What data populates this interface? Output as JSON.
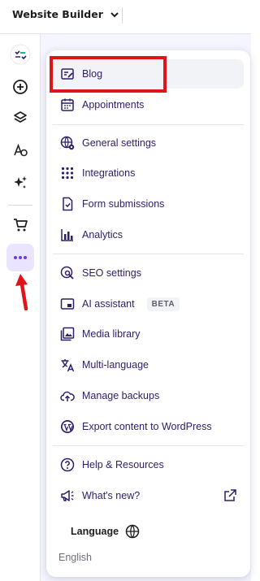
{
  "header": {
    "title": "Website Builder"
  },
  "sidebar": {
    "icons": [
      "logo-icon",
      "add-icon",
      "layers-icon",
      "typography-icon",
      "sparkle-icon",
      "cart-icon",
      "more-icon"
    ]
  },
  "menu": {
    "items": [
      {
        "label": "Blog",
        "icon": "blog-icon"
      },
      {
        "label": "Appointments",
        "icon": "calendar-icon"
      },
      {
        "label": "General settings",
        "icon": "globe-gear-icon"
      },
      {
        "label": "Integrations",
        "icon": "grid-icon"
      },
      {
        "label": "Form submissions",
        "icon": "document-icon"
      },
      {
        "label": "Analytics",
        "icon": "bar-chart-icon"
      },
      {
        "label": "SEO settings",
        "icon": "seo-icon"
      },
      {
        "label": "AI assistant",
        "icon": "ai-icon",
        "badge": "BETA"
      },
      {
        "label": "Media library",
        "icon": "image-icon"
      },
      {
        "label": "Multi-language",
        "icon": "translate-icon"
      },
      {
        "label": "Manage backups",
        "icon": "cloud-upload-icon"
      },
      {
        "label": "Export content to WordPress",
        "icon": "wordpress-icon"
      },
      {
        "label": "Help & Resources",
        "icon": "help-icon"
      },
      {
        "label": "What's new?",
        "icon": "megaphone-icon"
      }
    ],
    "language_label": "Language",
    "language_value": "English"
  },
  "colors": {
    "accent": "#673de6",
    "active_bg": "#ebe4ff",
    "highlight": "#e0151c",
    "text": "#2f1c6a"
  }
}
